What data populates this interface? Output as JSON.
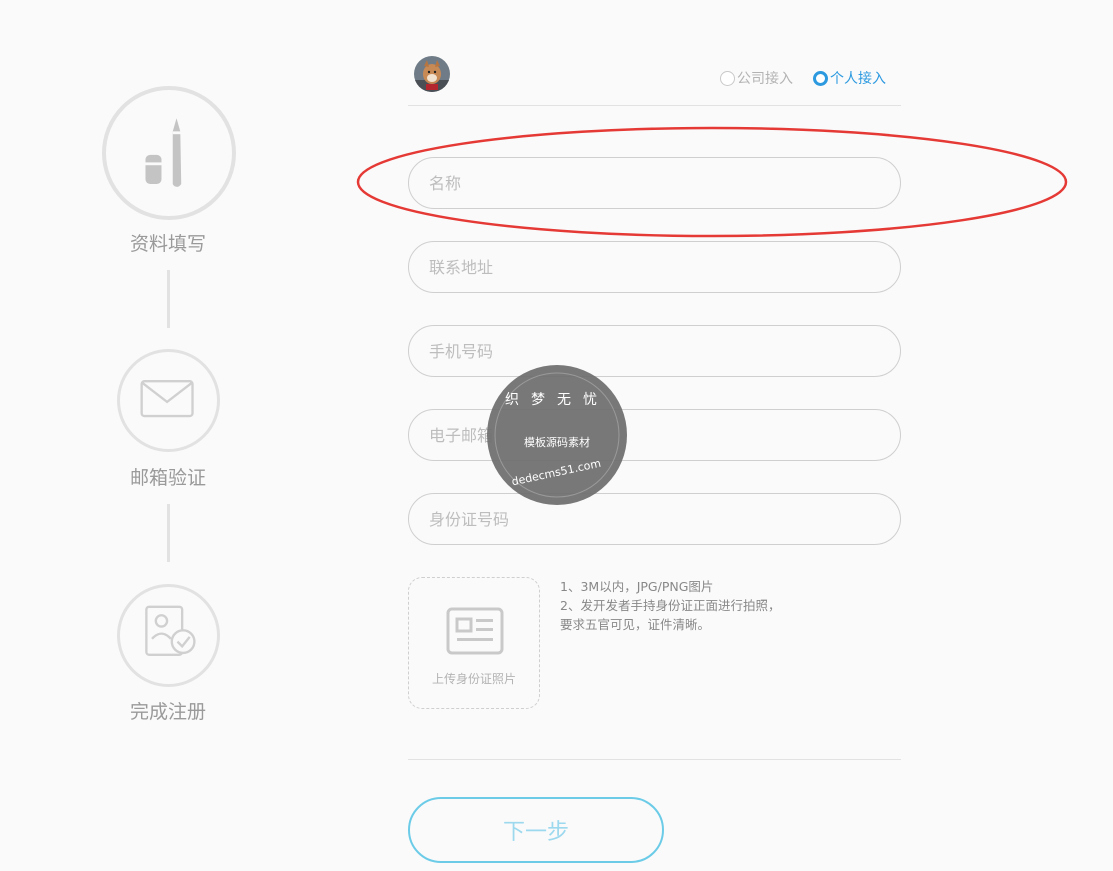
{
  "steps": [
    {
      "label": "资料填写",
      "icon": "pen-icon"
    },
    {
      "label": "邮箱验证",
      "icon": "envelope-icon"
    },
    {
      "label": "完成注册",
      "icon": "id-check-icon"
    }
  ],
  "header": {
    "avatar_icon": "avatar-dog-icon",
    "options": [
      {
        "label": "公司接入",
        "checked": false
      },
      {
        "label": "个人接入",
        "checked": true
      }
    ]
  },
  "form": {
    "fields": [
      {
        "placeholder": "名称"
      },
      {
        "placeholder": "联系地址"
      },
      {
        "placeholder": "手机号码"
      },
      {
        "placeholder": "电子邮箱"
      },
      {
        "placeholder": "身份证号码"
      }
    ],
    "upload_label": "上传身份证照片",
    "notes": [
      "1、3M以内，JPG/PNG图片",
      "2、发开发者手持身份证正面进行拍照，",
      "要求五官可见，证件清晰。"
    ]
  },
  "next_button": "下一步",
  "watermark": {
    "top_text": "织梦无忧",
    "middle_text": "模板源码素材",
    "bottom_text": "dedecms51.com"
  },
  "colors": {
    "accent": "#2d9ae0",
    "button_border": "#6ccce8",
    "annotation": "#e53935"
  }
}
